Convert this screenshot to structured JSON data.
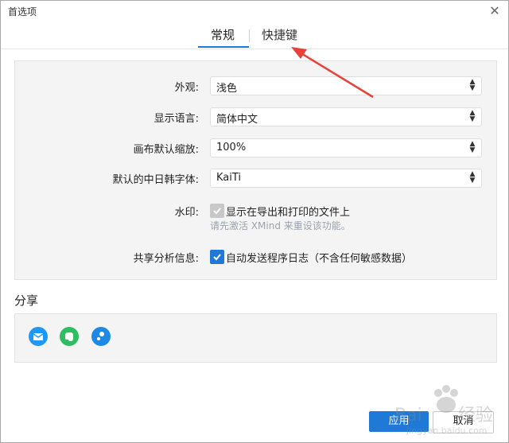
{
  "window": {
    "title": "首选项"
  },
  "tabs": [
    {
      "label": "常规"
    },
    {
      "label": "快捷键"
    }
  ],
  "general": {
    "appearance": {
      "label": "外观:",
      "value": "浅色"
    },
    "language": {
      "label": "显示语言:",
      "value": "简体中文"
    },
    "zoom": {
      "label": "画布默认缩放:",
      "value": "100%"
    },
    "cjk_font": {
      "label": "默认的中日韩字体:",
      "value": "KaiTi"
    },
    "watermark": {
      "label": "水印:",
      "checkbox_label": "显示在导出和打印的文件上",
      "hint": "请先激活 XMind 来重设该功能。",
      "checked": true,
      "disabled": true
    },
    "analytics": {
      "label": "共享分析信息:",
      "checkbox_label": "自动发送程序日志（不含任何敏感数据）",
      "checked": true
    }
  },
  "share": {
    "title": "分享",
    "icons": [
      {
        "name": "mail-icon",
        "color": "#2196f3"
      },
      {
        "name": "evernote-icon",
        "color": "#2dbe60"
      },
      {
        "name": "share-link-icon",
        "color": "#1e88e5"
      }
    ]
  },
  "footer": {
    "apply_label": "应用",
    "cancel_label": "取消"
  },
  "colors": {
    "accent": "#1e7ad6",
    "annotation_arrow": "#e8403a"
  }
}
